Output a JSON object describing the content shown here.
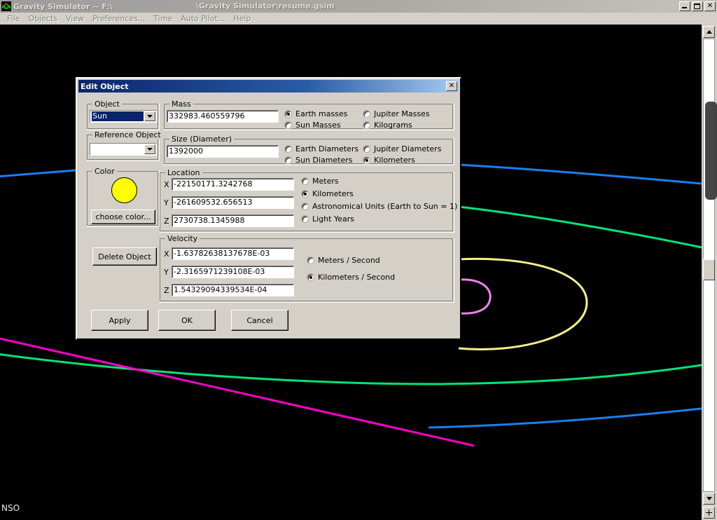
{
  "window": {
    "title": "Gravity Simulator -- F:\\",
    "document": "\\Gravity Simulator\\resume.gsim",
    "app_icon": "gravity-simulator-icon",
    "buttons": {
      "minimize": "_",
      "maximize": "❐",
      "close": "✕"
    }
  },
  "menu": {
    "items": [
      {
        "label": "File"
      },
      {
        "label": "Objects"
      },
      {
        "label": "View"
      },
      {
        "label": "Preferences..."
      },
      {
        "label": "Time"
      },
      {
        "label": "Auto Pilot..."
      },
      {
        "label": "Help"
      }
    ]
  },
  "canvas": {
    "status_text": "NSO",
    "background": "#000000",
    "orbits": [
      {
        "name": "blue-upper-left",
        "color": "#1a7ff0"
      },
      {
        "name": "blue-upper-right",
        "color": "#1a7ff0"
      },
      {
        "name": "green-upper",
        "color": "#00e676"
      },
      {
        "name": "green-lower",
        "color": "#00e676"
      },
      {
        "name": "yellow-inner",
        "color": "#f5f18a"
      },
      {
        "name": "magenta-inner",
        "color": "#ee82ee"
      },
      {
        "name": "magenta-lower",
        "color": "#ff00cc"
      },
      {
        "name": "blue-lower-right",
        "color": "#1a7ff0"
      }
    ]
  },
  "scrollbar": {
    "up_arrow": "▲",
    "down_arrow": "▼",
    "plus_button": "+"
  },
  "dialog": {
    "title": "Edit Object",
    "close_label": "✕",
    "object": {
      "group_label": "Object",
      "value": "Sun",
      "selected": true
    },
    "reference_object": {
      "group_label": "Reference Object",
      "value": ""
    },
    "color": {
      "group_label": "Color",
      "swatch_hex": "#FFFF00",
      "choose_button": "choose color..."
    },
    "delete_button": "Delete Object",
    "mass": {
      "group_label": "Mass",
      "value": "332983.460559796",
      "units": [
        {
          "label": "Earth masses",
          "selected": true
        },
        {
          "label": "Jupiter Masses",
          "selected": false
        },
        {
          "label": "Sun Masses",
          "selected": false
        },
        {
          "label": "Kilograms",
          "selected": false
        }
      ]
    },
    "size": {
      "group_label": "Size (Diameter)",
      "value": "1392000",
      "units": [
        {
          "label": "Earth Diameters",
          "selected": false
        },
        {
          "label": "Jupiter Diameters",
          "selected": false
        },
        {
          "label": "Sun Diameters",
          "selected": false
        },
        {
          "label": "Kilometers",
          "selected": true
        }
      ]
    },
    "location": {
      "group_label": "Location",
      "axis_labels": {
        "x": "X",
        "y": "Y",
        "z": "Z"
      },
      "x": "-22150171.3242768",
      "y": "-261609532.656513",
      "z": "2730738.1345988",
      "units": [
        {
          "label": "Meters",
          "selected": false
        },
        {
          "label": "Kilometers",
          "selected": true
        },
        {
          "label": "Astronomical Units (Earth to Sun = 1)",
          "selected": false
        },
        {
          "label": "Light Years",
          "selected": false
        }
      ]
    },
    "velocity": {
      "group_label": "Velocity",
      "axis_labels": {
        "x": "X",
        "y": "Y",
        "z": "Z"
      },
      "x": "-1.63782638137678E-03",
      "y": "-2.3165971239108E-03",
      "z": "1.54329094339534E-04",
      "units": [
        {
          "label": "Meters / Second",
          "selected": false
        },
        {
          "label": "Kilometers / Second",
          "selected": true
        }
      ]
    },
    "actions": {
      "apply": "Apply",
      "ok": "OK",
      "cancel": "Cancel"
    }
  }
}
